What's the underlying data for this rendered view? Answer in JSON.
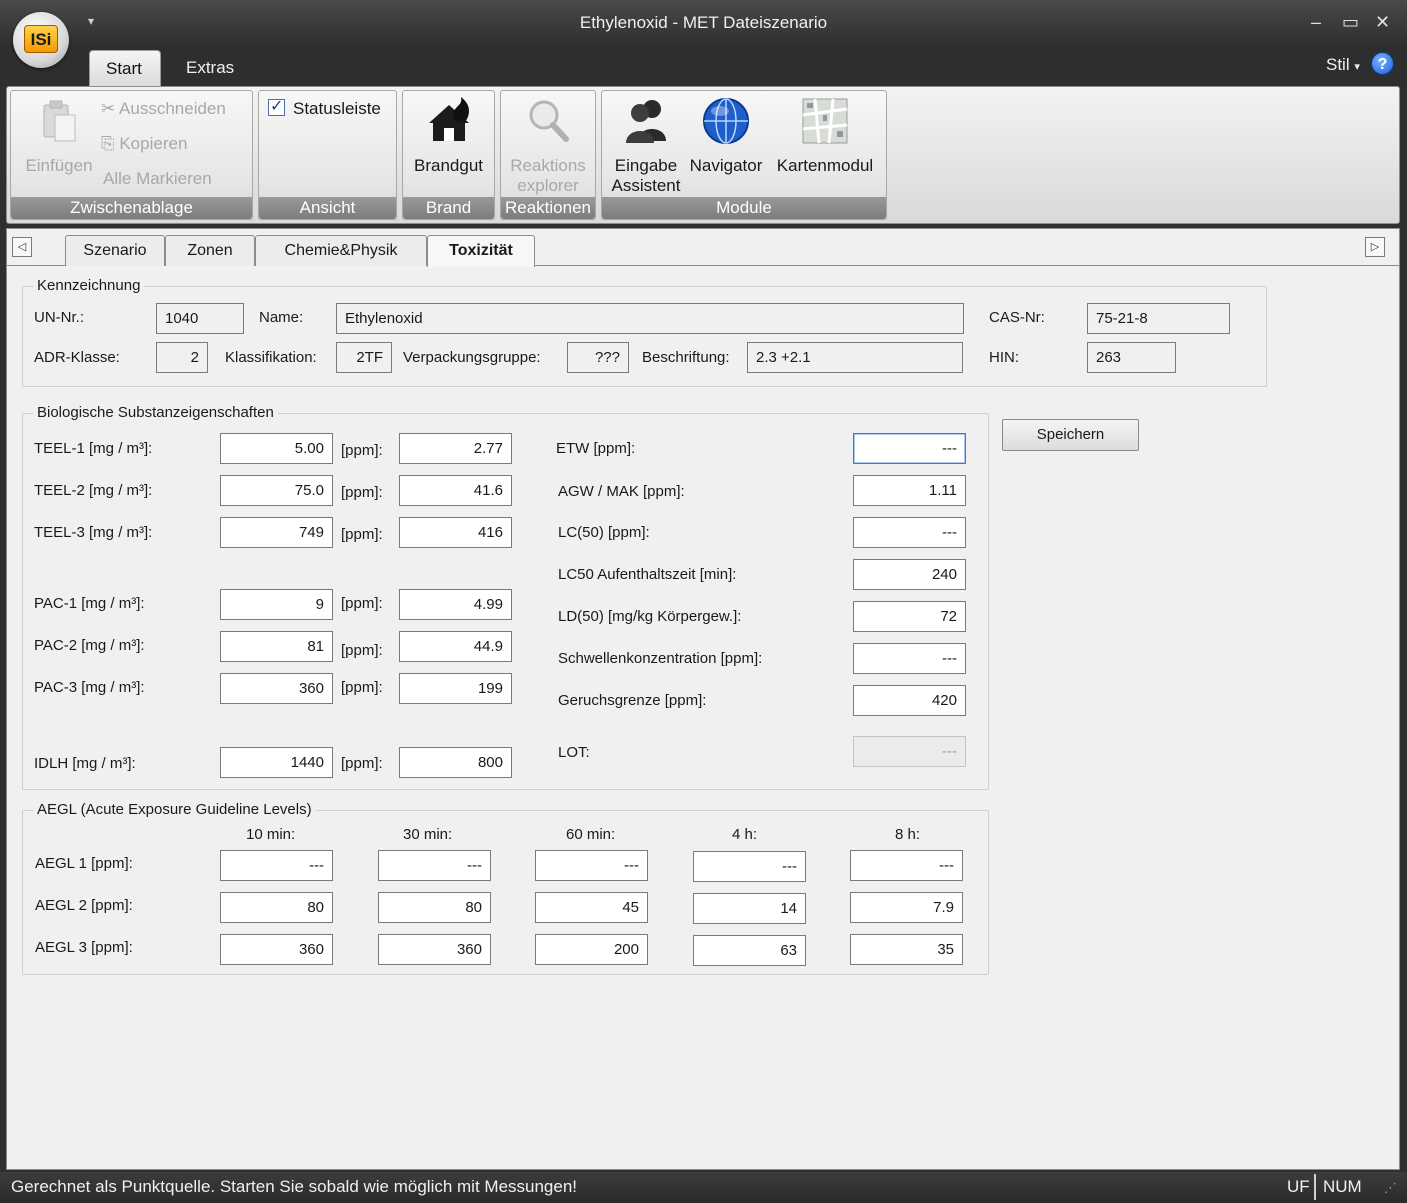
{
  "window": {
    "title": "Ethylenoxid - MET Dateiszenario",
    "logo_text": "ISi"
  },
  "ribbon_tabs": [
    {
      "label": "Start"
    },
    {
      "label": "Extras"
    }
  ],
  "style_menu": "Stil",
  "ribbon": {
    "clipboard": {
      "paste": "Einfügen",
      "cut": "Ausschneiden",
      "copy": "Kopieren",
      "select_all": "Alle Markieren",
      "group": "Zwischenablage"
    },
    "view": {
      "statusbar": "Statusleiste",
      "group": "Ansicht"
    },
    "fire": {
      "button": "Brandgut",
      "group": "Brand"
    },
    "reactions": {
      "button_line1": "Reaktions",
      "button_line2": "explorer",
      "group": "Reaktionen"
    },
    "modules": {
      "input_line1": "Eingabe",
      "input_line2": "Assistent",
      "navigator": "Navigator",
      "map": "Kartenmodul",
      "group": "Module"
    }
  },
  "doc_tabs": [
    {
      "label": "Szenario"
    },
    {
      "label": "Zonen"
    },
    {
      "label": "Chemie&Physik"
    },
    {
      "label": "Toxizität"
    }
  ],
  "kennzeichnung": {
    "title": "Kennzeichnung",
    "un_label": "UN-Nr.:",
    "un_value": "1040",
    "name_label": "Name:",
    "name_value": "Ethylenoxid",
    "cas_label": "CAS-Nr:",
    "cas_value": "75-21-8",
    "adr_label": "ADR-Klasse:",
    "adr_value": "2",
    "klass_label": "Klassifikation:",
    "klass_value": "2TF",
    "pack_label": "Verpackungsgruppe:",
    "pack_value": "???",
    "beschr_label": "Beschriftung:",
    "beschr_value": "2.3 +2.1",
    "hin_label": "HIN:",
    "hin_value": "263"
  },
  "bio": {
    "title": "Biologische Substanzeigenschaften",
    "ppm_unit": "[ppm]:",
    "rows": [
      {
        "label": "TEEL-1 [mg / m³]:",
        "mg": "5.00",
        "ppm": "2.77"
      },
      {
        "label": "TEEL-2 [mg / m³]:",
        "mg": "75.0",
        "ppm": "41.6"
      },
      {
        "label": "TEEL-3 [mg / m³]:",
        "mg": "749",
        "ppm": "416"
      },
      {
        "label": "PAC-1 [mg / m³]:",
        "mg": "9",
        "ppm": "4.99"
      },
      {
        "label": "PAC-2 [mg / m³]:",
        "mg": "81",
        "ppm": "44.9"
      },
      {
        "label": "PAC-3 [mg / m³]:",
        "mg": "360",
        "ppm": "199"
      },
      {
        "label": "IDLH [mg / m³]:",
        "mg": "1440",
        "ppm": "800"
      }
    ],
    "right": [
      {
        "label": "ETW [ppm]:",
        "value": "---"
      },
      {
        "label": "AGW / MAK [ppm]:",
        "value": "1.11"
      },
      {
        "label": "LC(50) [ppm]:",
        "value": "---"
      },
      {
        "label": "LC50 Aufenthaltszeit [min]:",
        "value": "240"
      },
      {
        "label": "LD(50) [mg/kg Körpergew.]:",
        "value": "72"
      },
      {
        "label": "Schwellenkonzentration [ppm]:",
        "value": "---"
      },
      {
        "label": "Geruchsgrenze [ppm]:",
        "value": "420"
      },
      {
        "label": "LOT:",
        "value": "---"
      }
    ]
  },
  "save_button": "Speichern",
  "aegl": {
    "title": "AEGL (Acute Exposure Guideline Levels)",
    "columns": [
      "10 min:",
      "30 min:",
      "60 min:",
      "4 h:",
      "8 h:"
    ],
    "rows": [
      {
        "label": "AEGL 1 [ppm]:",
        "values": [
          "---",
          "---",
          "---",
          "---",
          "---"
        ]
      },
      {
        "label": "AEGL 2 [ppm]:",
        "values": [
          "80",
          "80",
          "45",
          "14",
          "7.9"
        ]
      },
      {
        "label": "AEGL 3 [ppm]:",
        "values": [
          "360",
          "360",
          "200",
          "63",
          "35"
        ]
      }
    ]
  },
  "status": {
    "message": "Gerechnet als Punktquelle. Starten Sie sobald wie möglich mit Messungen!",
    "uf": "UF",
    "num": "NUM"
  }
}
